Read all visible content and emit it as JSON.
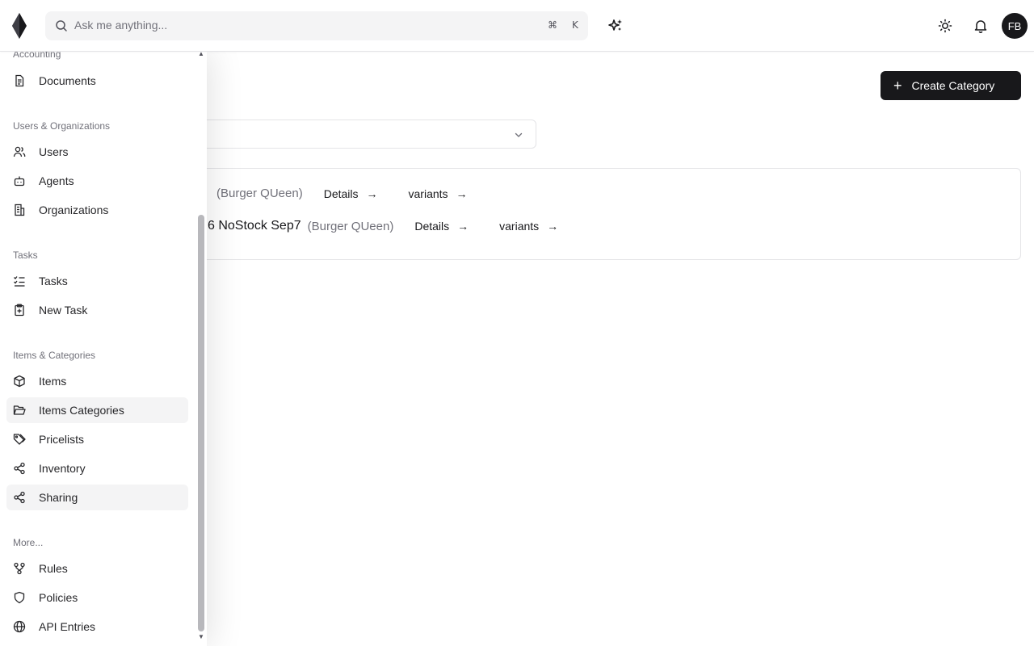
{
  "search": {
    "placeholder": "Ask me anything...",
    "shortcut_cmd": "⌘",
    "shortcut_key": "K"
  },
  "user": {
    "initials": "FB"
  },
  "main": {
    "create_label": "Create Category",
    "rows": [
      {
        "name": "",
        "org": "(Burger QUeen)",
        "details": "Details",
        "variants": "variants"
      },
      {
        "name": "6 NoStock Sep7",
        "org": "(Burger QUeen)",
        "details": "Details",
        "variants": "variants"
      }
    ]
  },
  "sidebar": {
    "groups": [
      "Accounting",
      "Users & Organizations",
      "Tasks",
      "Items & Categories",
      "More..."
    ],
    "items": [
      {
        "label": "Documents",
        "icon": "document-icon"
      },
      {
        "label": "Users",
        "icon": "users-icon"
      },
      {
        "label": "Agents",
        "icon": "bot-icon"
      },
      {
        "label": "Organizations",
        "icon": "building-icon"
      },
      {
        "label": "Tasks",
        "icon": "list-checks-icon"
      },
      {
        "label": "New Task",
        "icon": "clipboard-plus-icon"
      },
      {
        "label": "Items",
        "icon": "package-icon"
      },
      {
        "label": "Items Categories",
        "icon": "folder-open-icon",
        "active": true
      },
      {
        "label": "Pricelists",
        "icon": "tags-icon"
      },
      {
        "label": "Inventory",
        "icon": "share-icon"
      },
      {
        "label": "Sharing",
        "icon": "share-icon",
        "active": true
      },
      {
        "label": "Rules",
        "icon": "workflow-icon"
      },
      {
        "label": "Policies",
        "icon": "shield-icon"
      },
      {
        "label": "API Entries",
        "icon": "globe-icon"
      }
    ]
  }
}
